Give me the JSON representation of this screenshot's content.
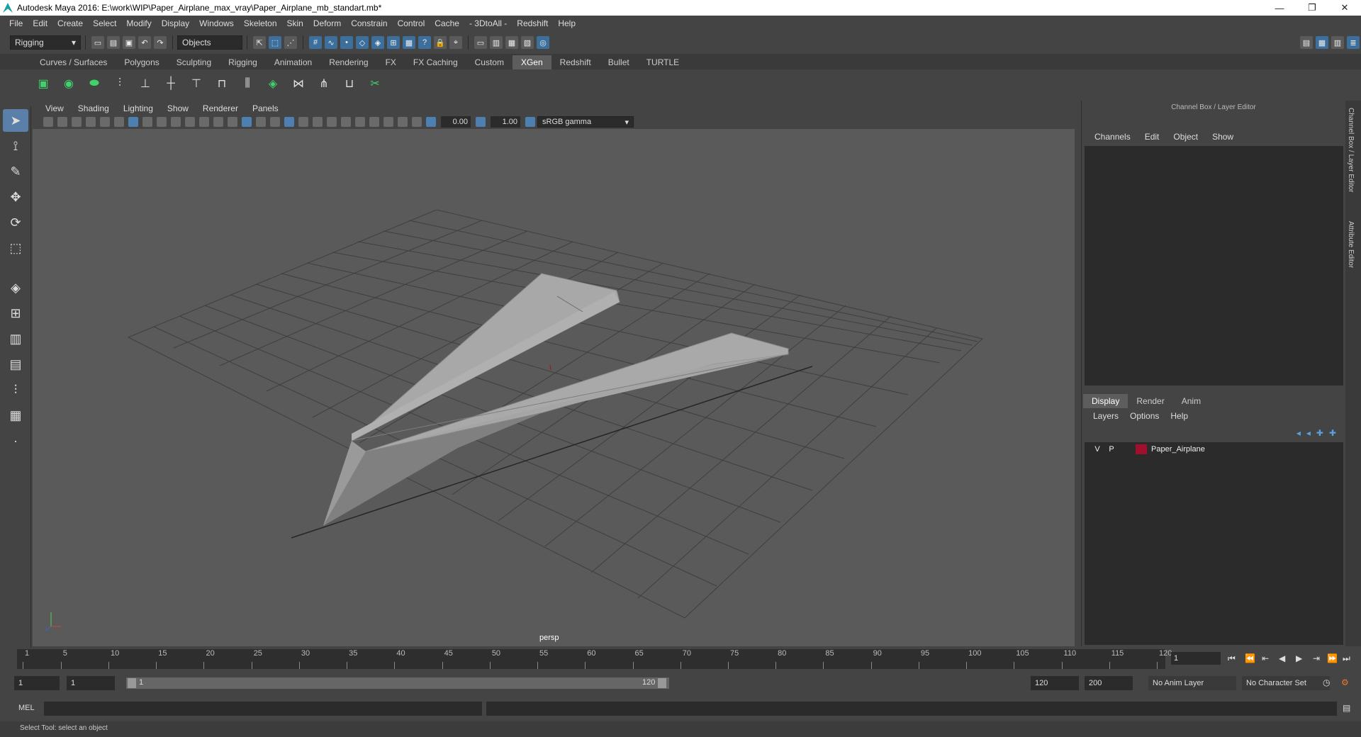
{
  "window": {
    "title": "Autodesk Maya 2016: E:\\work\\WIP\\Paper_Airplane_max_vray\\Paper_Airplane_mb_standart.mb*",
    "controls": [
      "—",
      "❐",
      "✕"
    ]
  },
  "menubar": {
    "items": [
      "File",
      "Edit",
      "Create",
      "Select",
      "Modify",
      "Display",
      "Windows",
      "Skeleton",
      "Skin",
      "Deform",
      "Constrain",
      "Control",
      "Cache",
      "- 3DtoAll -",
      "Redshift",
      "Help"
    ]
  },
  "statusline": {
    "menuset": "Rigging",
    "selection_mode": "Objects"
  },
  "shelf": {
    "tabs": [
      "Curves / Surfaces",
      "Polygons",
      "Sculpting",
      "Rigging",
      "Animation",
      "Rendering",
      "FX",
      "FX Caching",
      "Custom",
      "XGen",
      "Redshift",
      "Bullet",
      "TURTLE"
    ],
    "active_tab": "XGen"
  },
  "viewport": {
    "menu": [
      "View",
      "Shading",
      "Lighting",
      "Show",
      "Renderer",
      "Panels"
    ],
    "exposure": "0.00",
    "gamma": "1.00",
    "color_space": "sRGB gamma",
    "camera_label": "persp"
  },
  "channelbox": {
    "title": "Channel Box / Layer Editor",
    "menu": [
      "Channels",
      "Edit",
      "Object",
      "Show"
    ],
    "layer_tabs": [
      "Display",
      "Render",
      "Anim"
    ],
    "active_layer_tab": "Display",
    "layer_menu": [
      "Layers",
      "Options",
      "Help"
    ],
    "layers": [
      {
        "v": "V",
        "p": "P",
        "color": "#a0102c",
        "name": "Paper_Airplane"
      }
    ],
    "side_tabs": [
      "Channel Box / Layer Editor",
      "Attribute Editor"
    ]
  },
  "timeslider": {
    "tick_labels": [
      "1",
      "5",
      "10",
      "15",
      "20",
      "25",
      "30",
      "35",
      "40",
      "45",
      "50",
      "55",
      "60",
      "65",
      "70",
      "75",
      "80",
      "85",
      "90",
      "95",
      "100",
      "105",
      "110",
      "115",
      "120"
    ],
    "current_frame": "1"
  },
  "rangeslider": {
    "start_field": "1",
    "start_field2": "1",
    "range_start": "1",
    "range_end": "120",
    "end_field": "120",
    "end_field2": "200",
    "anim_layer": "No Anim Layer",
    "character_set": "No Character Set"
  },
  "mel": {
    "label": "MEL"
  },
  "help": {
    "text": "Select Tool: select an object"
  }
}
